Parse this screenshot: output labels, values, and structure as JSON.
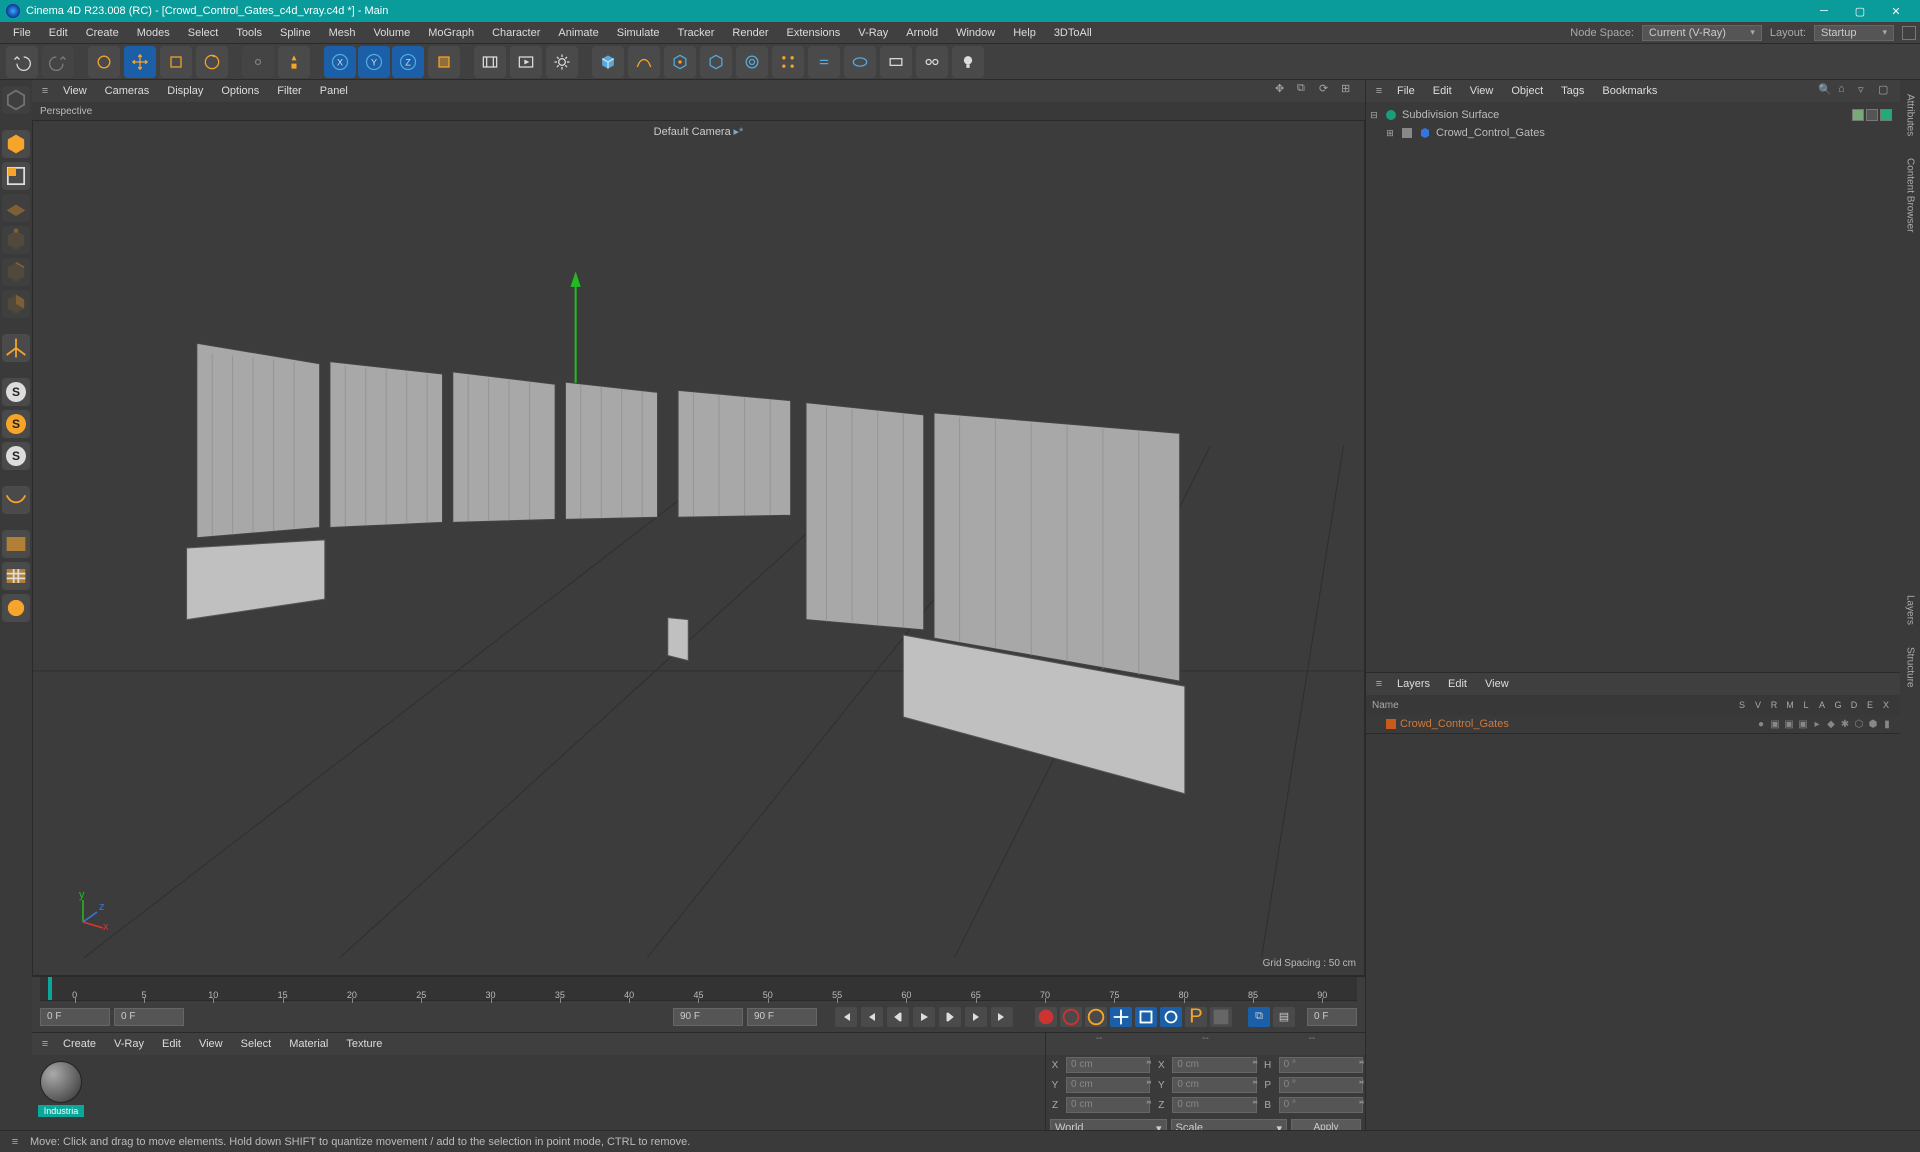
{
  "title": "Cinema 4D R23.008 (RC) - [Crowd_Control_Gates_c4d_vray.c4d *] - Main",
  "mainMenu": [
    "File",
    "Edit",
    "Create",
    "Modes",
    "Select",
    "Tools",
    "Spline",
    "Mesh",
    "Volume",
    "MoGraph",
    "Character",
    "Animate",
    "Simulate",
    "Tracker",
    "Render",
    "Extensions",
    "V-Ray",
    "Arnold",
    "Window",
    "Help",
    "3DToAll"
  ],
  "nodeSpaceLabel": "Node Space:",
  "nodeSpaceValue": "Current (V-Ray)",
  "layoutLabel": "Layout:",
  "layoutValue": "Startup",
  "viewportMenu": [
    "View",
    "Cameras",
    "Display",
    "Options",
    "Filter",
    "Panel"
  ],
  "viewportTitle": "Perspective",
  "viewportCamera": "Default Camera",
  "gridSpacing": "Grid Spacing : 50 cm",
  "timeline": {
    "start": "0 F",
    "cur": "0 F",
    "endA": "90 F",
    "endB": "90 F",
    "endR": "0 F",
    "ticks": [
      "0",
      "5",
      "10",
      "15",
      "20",
      "25",
      "30",
      "35",
      "40",
      "45",
      "50",
      "55",
      "60",
      "65",
      "70",
      "75",
      "80",
      "85",
      "90"
    ]
  },
  "materialMenu": [
    "Create",
    "V-Ray",
    "Edit",
    "View",
    "Select",
    "Material",
    "Texture"
  ],
  "materials": [
    {
      "name": "Industria"
    }
  ],
  "coords": {
    "placeholder": "-- ",
    "X": "0 cm",
    "Y": "0 cm",
    "Z": "0 cm",
    "sX": "0 cm",
    "sY": "0 cm",
    "sZ": "0 cm",
    "H": "0 °",
    "P": "0 °",
    "B": "0 °",
    "ddA": "World",
    "ddB": "Scale",
    "apply": "Apply"
  },
  "objectsMenu": [
    "File",
    "Edit",
    "View",
    "Object",
    "Tags",
    "Bookmarks"
  ],
  "tree": {
    "a": {
      "name": "Subdivision Surface"
    },
    "b": {
      "name": "Crowd_Control_Gates"
    }
  },
  "layersMenu": [
    "Layers",
    "Edit",
    "View"
  ],
  "layersHead": {
    "name": "Name",
    "cols": [
      "S",
      "V",
      "R",
      "M",
      "L",
      "A",
      "G",
      "D",
      "E",
      "X"
    ]
  },
  "layersRow": {
    "name": "Crowd_Control_Gates"
  },
  "status": "Move: Click and drag to move elements. Hold down SHIFT to quantize movement / add to the selection in point mode, CTRL to remove."
}
